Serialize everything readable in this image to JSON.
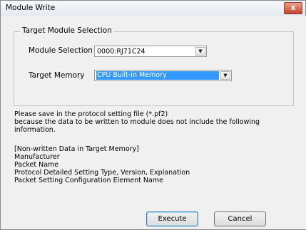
{
  "window": {
    "title": "Module Write",
    "close_label": "x"
  },
  "group": {
    "legend": "Target Module Selection",
    "module_selection": {
      "label": "Module Selection",
      "value": "0000:RJ71C24"
    },
    "target_memory": {
      "label": "Target Memory",
      "value": "CPU Built-in Memory"
    }
  },
  "message": {
    "line1": "Please save in the protocol setting file (*.pf2)",
    "line2": "because the data to be written to module does not include the following",
    "line3": "information."
  },
  "non_written": {
    "header": "[Non-written Data in Target Memory]",
    "items": [
      "Manufacturer",
      "Packet Name",
      "Protocol Detailed Setting Type, Version, Explanation",
      "Packet Setting Configuration Element Name"
    ]
  },
  "buttons": {
    "execute": "Execute",
    "cancel": "Cancel"
  }
}
